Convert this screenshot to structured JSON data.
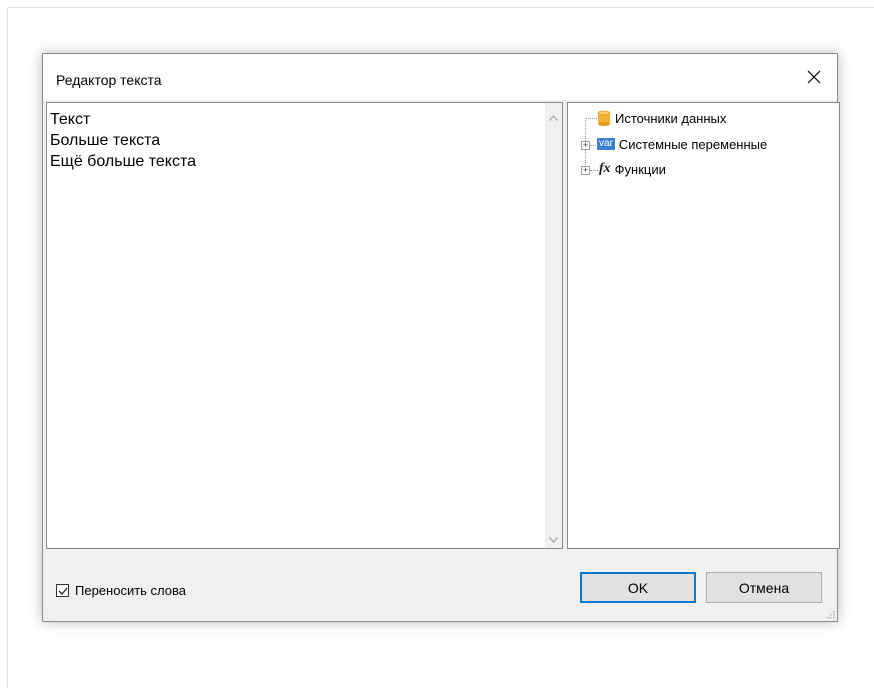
{
  "dialog": {
    "title": "Редактор текста",
    "close_icon": "close-icon"
  },
  "editor": {
    "text": "Текст\nБольше текста\nЕщё больше текста",
    "scroll_up_icon": "chevron-up-icon",
    "scroll_down_icon": "chevron-down-icon"
  },
  "tree": {
    "items": [
      {
        "label": "Источники данных",
        "icon": "database-icon",
        "expandable": false
      },
      {
        "label": "Системные переменные",
        "icon": "var-icon",
        "icon_text": "var",
        "expandable": true
      },
      {
        "label": "Функции",
        "icon": "function-icon",
        "icon_text": "fx",
        "expandable": true
      }
    ]
  },
  "footer": {
    "wrap_label": "Переносить слова",
    "wrap_checked": true,
    "ok_label": "OK",
    "cancel_label": "Отмена"
  },
  "colors": {
    "accent": "#0078d7",
    "var_badge": "#3b7fd4",
    "database": "#f2b233"
  }
}
